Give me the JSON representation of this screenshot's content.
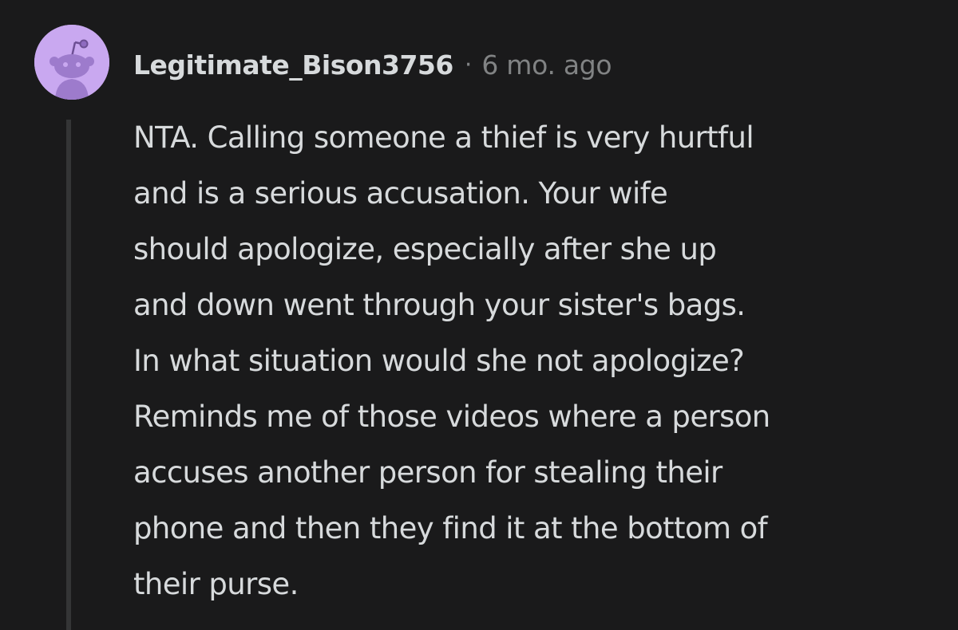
{
  "comment": {
    "username": "Legitimate_Bison3756",
    "separator": "·",
    "timestamp": "6 mo. ago",
    "avatar_icon": "snoo-avatar-icon",
    "avatar_color": "#c9a8f0",
    "body_lines": [
      "NTA. Calling someone a thief is very hurtful",
      "and is a serious accusation. Your wife",
      "should apologize, especially after she up",
      "and down went through your sister's bags.",
      "In what situation would she not apologize?",
      "Reminds me of those videos where a person",
      "accuses another person for stealing their",
      "phone and then they find it at the bottom of",
      "their purse."
    ]
  },
  "colors": {
    "background": "#1a1a1b",
    "text": "#d7dadc",
    "meta": "#818384",
    "thread_line": "#343536"
  }
}
